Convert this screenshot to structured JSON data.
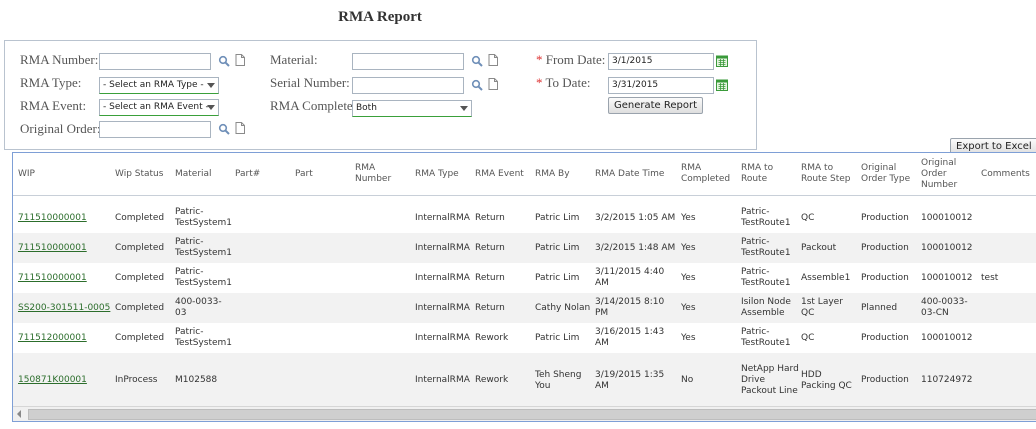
{
  "title": "RMA Report",
  "filters": {
    "rma_number_label": "RMA Number:",
    "rma_number_value": "",
    "rma_type_label": "RMA Type:",
    "rma_type_value": "- Select an RMA Type -",
    "rma_event_label": "RMA Event:",
    "rma_event_value": "- Select an RMA Event -",
    "original_order_label": "Original Order:",
    "original_order_value": "",
    "material_label": "Material:",
    "material_value": "",
    "serial_number_label": "Serial Number:",
    "serial_number_value": "",
    "rma_complete_label": "RMA Complete:",
    "rma_complete_value": "Both",
    "from_date_label": "From Date:",
    "from_date_value": "3/1/2015",
    "to_date_label": "To Date:",
    "to_date_value": "3/31/2015",
    "required_mark": "*",
    "generate_label": "Generate Report",
    "export_label": "Export to Excel"
  },
  "icons": {
    "search": "search-icon",
    "document": "document-icon",
    "calendar": "calendar-icon"
  },
  "colors": {
    "link": "#2c6e2c",
    "required": "#dd3333",
    "grid_border": "#7e9fd6",
    "calendar": "#3a9a3a"
  },
  "grid": {
    "headers": [
      "WIP",
      "Wip Status",
      "Material",
      "Part#",
      "Part",
      "RMA Number",
      "RMA Type",
      "RMA Event",
      "RMA By",
      "RMA Date Time",
      "RMA Completed",
      "RMA to Route",
      "RMA to Route Step",
      "Original Order Type",
      "Original Order Number",
      "Comments"
    ],
    "rows": [
      [
        "711510000001",
        "Completed",
        "Patric-TestSystem1",
        "",
        "",
        "",
        "InternalRMA",
        "Return",
        "Patric Lim",
        "3/2/2015 1:05 AM",
        "Yes",
        "Patric-TestRoute1",
        "QC",
        "Production",
        "100010012",
        ""
      ],
      [
        "711510000001",
        "Completed",
        "Patric-TestSystem1",
        "",
        "",
        "",
        "InternalRMA",
        "Return",
        "Patric Lim",
        "3/2/2015 1:48 AM",
        "Yes",
        "Patric-TestRoute1",
        "Packout",
        "Production",
        "100010012",
        ""
      ],
      [
        "711510000001",
        "Completed",
        "Patric-TestSystem1",
        "",
        "",
        "",
        "InternalRMA",
        "Return",
        "Patric Lim",
        "3/11/2015 4:40 AM",
        "Yes",
        "Patric-TestRoute1",
        "Assemble1",
        "Production",
        "100010012",
        "test"
      ],
      [
        "SS200-301511-0005",
        "Completed",
        "400-0033-03",
        "",
        "",
        "",
        "InternalRMA",
        "Return",
        "Cathy Nolan",
        "3/14/2015 8:10 PM",
        "Yes",
        "Isilon Node Assemble",
        "1st Layer QC",
        "Planned",
        "400-0033-03-CN",
        ""
      ],
      [
        "711512000001",
        "Completed",
        "Patric-TestSystem1",
        "",
        "",
        "",
        "InternalRMA",
        "Rework",
        "Patric Lim",
        "3/16/2015 1:43 AM",
        "Yes",
        "Patric-TestRoute1",
        "QC",
        "Production",
        "100010012",
        ""
      ],
      [
        "150871K00001",
        "InProcess",
        "M102588",
        "",
        "",
        "",
        "InternalRMA",
        "Rework",
        "Teh Sheng You",
        "3/19/2015 1:35 AM",
        "No",
        "NetApp Hard Drive Packout Line",
        "HDD Packing QC",
        "Production",
        "110724972",
        ""
      ]
    ]
  }
}
